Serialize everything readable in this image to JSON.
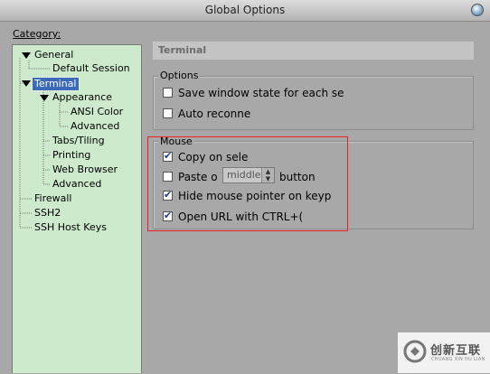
{
  "window": {
    "title": "Global Options"
  },
  "category_label": "Category:",
  "tree": {
    "items": [
      {
        "label": "General"
      },
      {
        "label": "Default Session"
      },
      {
        "label": "Terminal"
      },
      {
        "label": "Appearance"
      },
      {
        "label": "ANSI Color"
      },
      {
        "label": "Advanced"
      },
      {
        "label": "Tabs/Tiling"
      },
      {
        "label": "Printing"
      },
      {
        "label": "Web Browser"
      },
      {
        "label": "Advanced"
      },
      {
        "label": "Firewall"
      },
      {
        "label": "SSH2"
      },
      {
        "label": "SSH Host Keys"
      }
    ]
  },
  "panel": {
    "header": "Terminal",
    "options_group": {
      "legend": "Options",
      "items": [
        {
          "label": "Save window state for each se",
          "checked": false
        },
        {
          "label": "Auto reconne",
          "checked": false
        }
      ]
    },
    "mouse_group": {
      "legend": "Mouse",
      "copy_on_select": {
        "label": "Copy on sele",
        "checked": true
      },
      "paste": {
        "label": "Paste o",
        "checked": false,
        "select_value": "middle",
        "suffix": "button"
      },
      "hide_pointer": {
        "label": "Hide mouse pointer on keyp",
        "checked": true
      },
      "open_url": {
        "label": "Open URL with CTRL+(",
        "checked": true
      }
    }
  },
  "watermark": {
    "text_cn": "创新互联",
    "text_en": "CHUANG XIN HU LIAN"
  },
  "colors": {
    "tree_bg": "#cdeacd",
    "selection": "#3b6ab8",
    "highlight": "#e22222"
  }
}
